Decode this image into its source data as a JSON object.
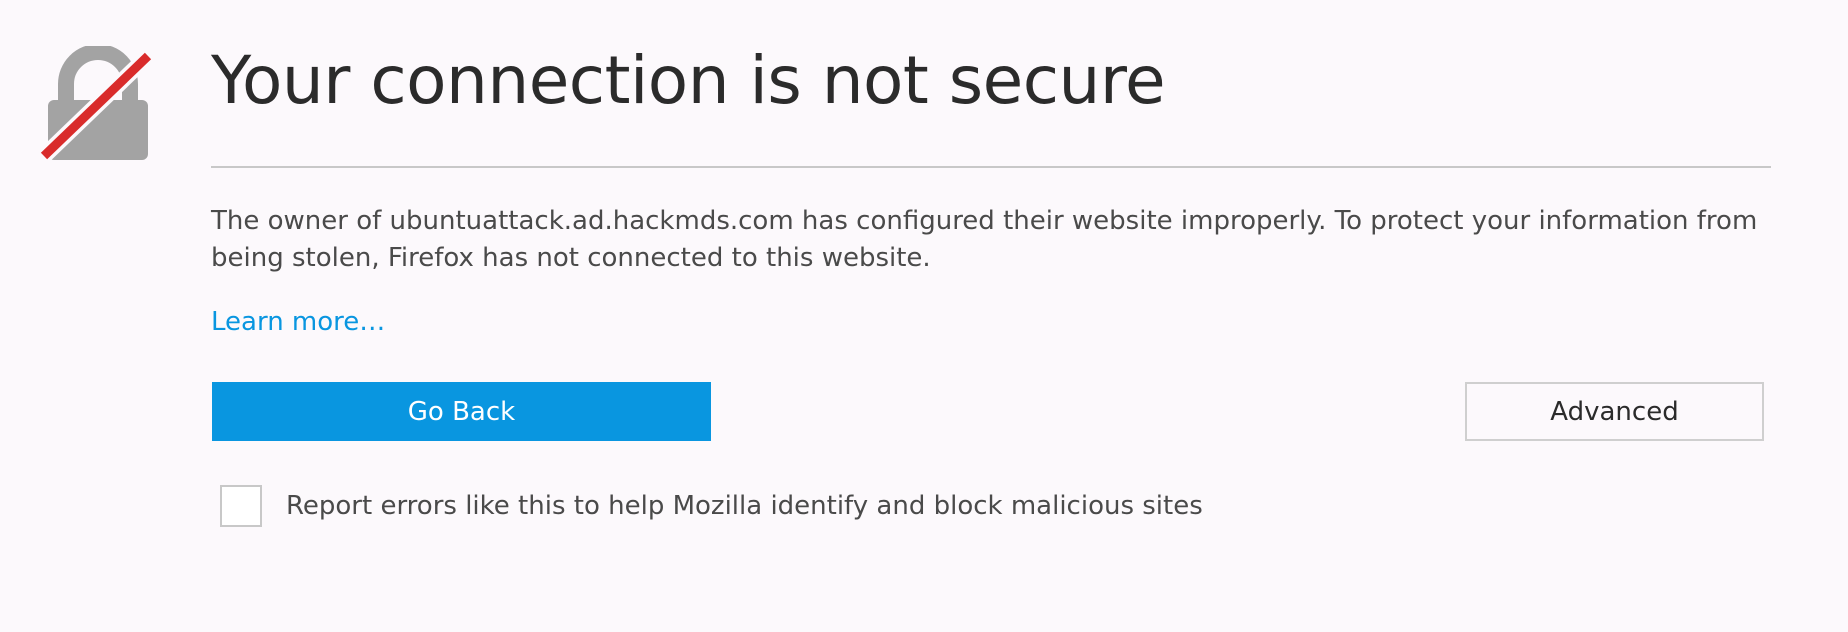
{
  "error_page": {
    "icon": "broken-lock-icon",
    "title": "Your connection is not secure",
    "description": "The owner of ubuntuattack.ad.hackmds.com has configured their website improperly. To protect your information from being stolen, Firefox has not connected to this website.",
    "learn_more": "Learn more…",
    "go_back_label": "Go Back",
    "advanced_label": "Advanced",
    "report_label": "Report errors like this to help Mozilla identify and block malicious sites",
    "report_checked": false
  },
  "colors": {
    "background": "#fcf9fc",
    "accent": "#0996e0",
    "lock_gray": "#a3a3a3",
    "slash_red": "#d92b2b",
    "title_text": "#2b2b2b",
    "body_text": "#4a4a4a"
  }
}
